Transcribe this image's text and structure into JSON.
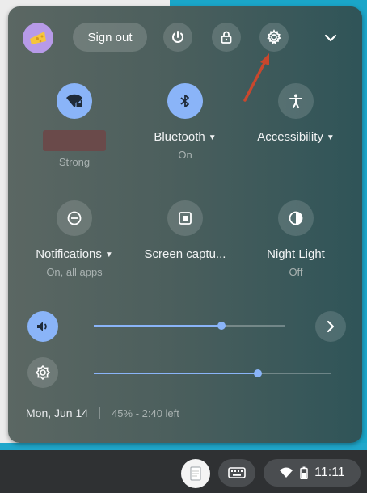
{
  "header": {
    "sign_out_label": "Sign out"
  },
  "tiles": [
    {
      "label": "",
      "sub": "Strong",
      "icon": "wifi-locked-icon",
      "state": "on"
    },
    {
      "label": "Bluetooth",
      "sub": "On",
      "icon": "bluetooth-icon",
      "state": "on"
    },
    {
      "label": "Accessibility",
      "sub": "",
      "icon": "accessibility-icon",
      "state": "off"
    },
    {
      "label": "Notifications",
      "sub": "On, all apps",
      "icon": "do-not-disturb-icon",
      "state": "off"
    },
    {
      "label": "Screen captu...",
      "sub": "",
      "icon": "screen-capture-icon",
      "state": "off"
    },
    {
      "label": "Night Light",
      "sub": "Off",
      "icon": "night-light-icon",
      "state": "off"
    }
  ],
  "sliders": {
    "volume_level": 0.67,
    "brightness_level": 0.69
  },
  "footer": {
    "date": "Mon, Jun 14",
    "battery": "45% - 2:40 left"
  },
  "shelf": {
    "time": "11:11"
  },
  "colors": {
    "accent": "#8ab4f8",
    "annotation_arrow": "#c9472d"
  }
}
